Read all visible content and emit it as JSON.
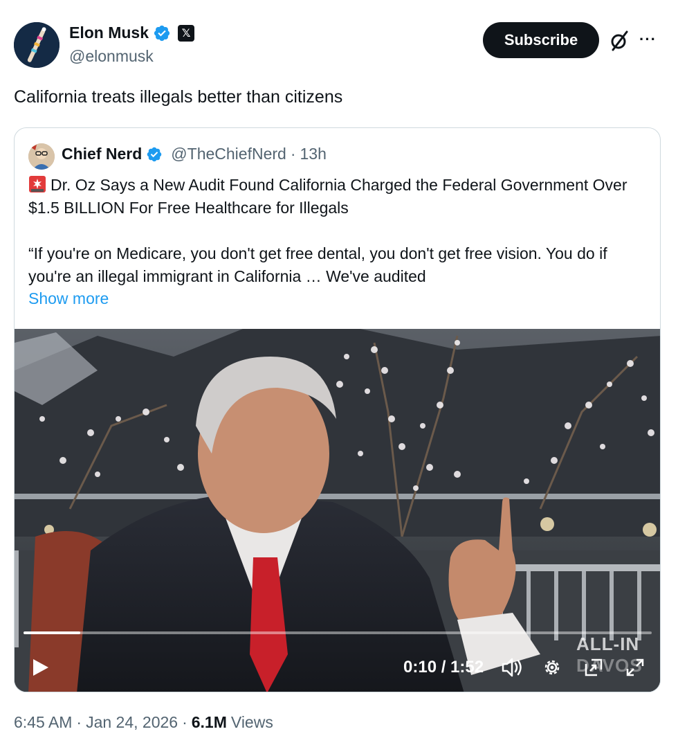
{
  "author": {
    "name": "Elon Musk",
    "handle": "@elonmusk",
    "x_badge": "𝕏"
  },
  "actions": {
    "subscribe_label": "Subscribe",
    "more_label": "···"
  },
  "tweet": {
    "text": "California treats illegals better than citizens"
  },
  "quote": {
    "name": "Chief Nerd",
    "handle": "@TheChiefNerd",
    "separator": "·",
    "time": "13h",
    "headline": "Dr. Oz Says a New Audit Found California Charged the Federal Government Over $1.5 BILLION For Free Healthcare for Illegals",
    "quote_text": "“If you're on Medicare, you don't get free dental, you don't get free vision. You do if you're an illegal immigrant in California … We've audited",
    "show_more": "Show more"
  },
  "video": {
    "time_display": "0:10 / 1:52",
    "progress": 0.09,
    "watermark": "ALL-IN",
    "watermark_sub": "DAVOS"
  },
  "footer": {
    "time": "6:45 AM",
    "dot1": "·",
    "date": "Jan 24, 2026",
    "dot2": "·",
    "views_count": "6.1M",
    "views_label": "Views"
  },
  "colors": {
    "accent": "#1d9bf0",
    "text": "#0f1419",
    "muted": "#536471",
    "border": "#cfd9de"
  }
}
